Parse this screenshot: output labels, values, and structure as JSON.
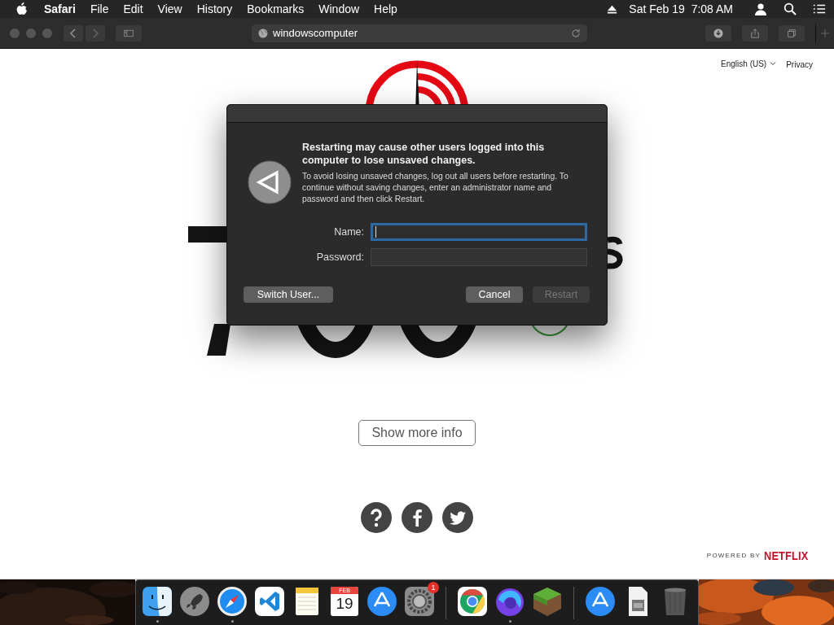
{
  "menu_bar": {
    "app_name": "Safari",
    "menus": [
      "File",
      "Edit",
      "View",
      "History",
      "Bookmarks",
      "Window",
      "Help"
    ],
    "clock": "Sat Feb 19  7:08 AM"
  },
  "toolbar": {
    "address": "windowscomputer"
  },
  "page": {
    "language": "English (US)",
    "privacy": "Privacy",
    "button": "Show more info",
    "powered_by": "POWERED BY",
    "brand": "NETFLIX"
  },
  "dialog": {
    "title": "Restarting may cause other users logged into this computer to lose unsaved changes.",
    "message": "To avoid losing unsaved changes, log out all users before restarting. To continue without saving changes, enter an administrator name and password and then click Restart.",
    "fields": [
      {
        "label": "Name:",
        "focused": true
      },
      {
        "label": "Password:",
        "focused": false
      }
    ],
    "buttons": [
      {
        "label": "Switch User...",
        "disabled": false
      },
      {
        "label": "Cancel",
        "disabled": false
      },
      {
        "label": "Restart",
        "disabled": true
      }
    ]
  },
  "dock": [
    {
      "kind": "finder",
      "running": true
    },
    {
      "kind": "launchpad",
      "running": false
    },
    {
      "kind": "safari",
      "running": true
    },
    {
      "kind": "code",
      "running": false
    },
    {
      "kind": "notes",
      "running": false
    },
    {
      "kind": "calendar",
      "running": false,
      "month": "FEB",
      "day": "19"
    },
    {
      "kind": "store",
      "running": false
    },
    {
      "kind": "settings",
      "running": false,
      "badge": "1"
    },
    {
      "kind": "separator"
    },
    {
      "kind": "chrome",
      "running": false
    },
    {
      "kind": "firefox",
      "running": true
    },
    {
      "kind": "block",
      "running": false
    },
    {
      "kind": "separator"
    },
    {
      "kind": "store",
      "running": false
    },
    {
      "kind": "document",
      "running": false
    },
    {
      "kind": "trash",
      "running": false
    }
  ]
}
